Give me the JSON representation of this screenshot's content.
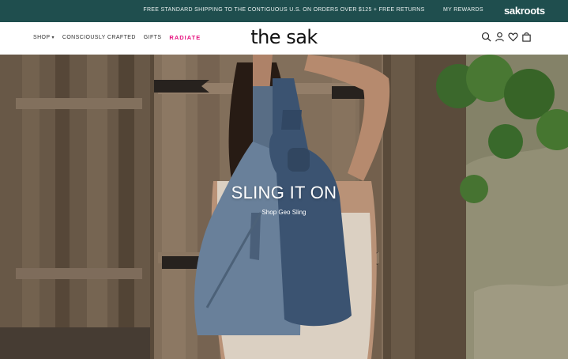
{
  "promo": {
    "shipping_text": "FREE STANDARD SHIPPING TO THE CONTIGUOUS U.S. ON ORDERS OVER $125 + FREE RETURNS",
    "rewards_label": "MY REWARDS",
    "partner_logo": "sakroots"
  },
  "header": {
    "logo": "the sak",
    "nav": [
      {
        "label": "SHOP",
        "has_dropdown": true
      },
      {
        "label": "CONSCIOUSLY CRAFTED"
      },
      {
        "label": "GIFTS"
      },
      {
        "label": "RADIATE"
      }
    ],
    "icons": [
      "search-icon",
      "account-icon",
      "wishlist-icon",
      "bag-icon"
    ]
  },
  "hero": {
    "title": "SLING IT ON",
    "link_label": "Shop Geo Sling"
  },
  "colors": {
    "promo_bg": "#1f4e4e",
    "radiate_accent": "#e6127f"
  }
}
